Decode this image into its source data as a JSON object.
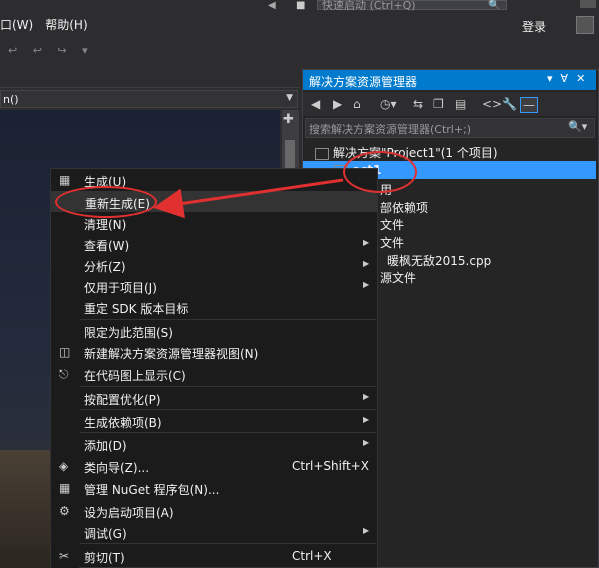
{
  "menu": {
    "items": [
      "口(W)",
      "帮助(H)"
    ]
  },
  "quick_launch": {
    "placeholder": "快速启动 (Ctrl+Q)"
  },
  "header": {
    "login": "登录"
  },
  "editor": {
    "combo_text": "n()"
  },
  "solution_explorer": {
    "title": "解决方案资源管理器",
    "search_placeholder": "搜索解决方案资源管理器(Ctrl+;)",
    "tree": [
      "解决方案\"Project1\"(1 个项目)",
      "ect1",
      "用",
      "部依赖项",
      "文件",
      "文件",
      "暖枫无敌2015.cpp",
      "源文件"
    ]
  },
  "context_menu": {
    "items": [
      {
        "label": "生成(U)",
        "icon": "build-icon"
      },
      {
        "label": "重新生成(E)",
        "icon": ""
      },
      {
        "label": "清理(N)",
        "icon": ""
      },
      {
        "label": "查看(W)",
        "icon": "",
        "submenu": true
      },
      {
        "label": "分析(Z)",
        "icon": "",
        "submenu": true
      },
      {
        "label": "仅用于项目(J)",
        "icon": "",
        "submenu": true
      },
      {
        "label": "重定 SDK 版本目标",
        "icon": ""
      },
      {
        "label": "限定为此范围(S)",
        "icon": ""
      },
      {
        "label": "新建解决方案资源管理器视图(N)",
        "icon": "new-view-icon"
      },
      {
        "label": "在代码图上显示(C)",
        "icon": "code-map-icon"
      },
      {
        "label": "按配置优化(P)",
        "icon": "",
        "submenu": true
      },
      {
        "label": "生成依赖项(B)",
        "icon": "",
        "submenu": true
      },
      {
        "label": "添加(D)",
        "icon": "",
        "submenu": true
      },
      {
        "label": "类向导(Z)...",
        "icon": "class-wizard-icon",
        "shortcut": "Ctrl+Shift+X"
      },
      {
        "label": "管理 NuGet 程序包(N)...",
        "icon": "nuget-icon"
      },
      {
        "label": "设为启动项目(A)",
        "icon": "gear-icon"
      },
      {
        "label": "调试(G)",
        "icon": "",
        "submenu": true
      },
      {
        "label": "剪切(T)",
        "icon": "scissors-icon",
        "shortcut": "Ctrl+X"
      }
    ]
  },
  "colors": {
    "accent": "#007acc",
    "selection": "#3399ff",
    "annotation": "#e03030"
  }
}
